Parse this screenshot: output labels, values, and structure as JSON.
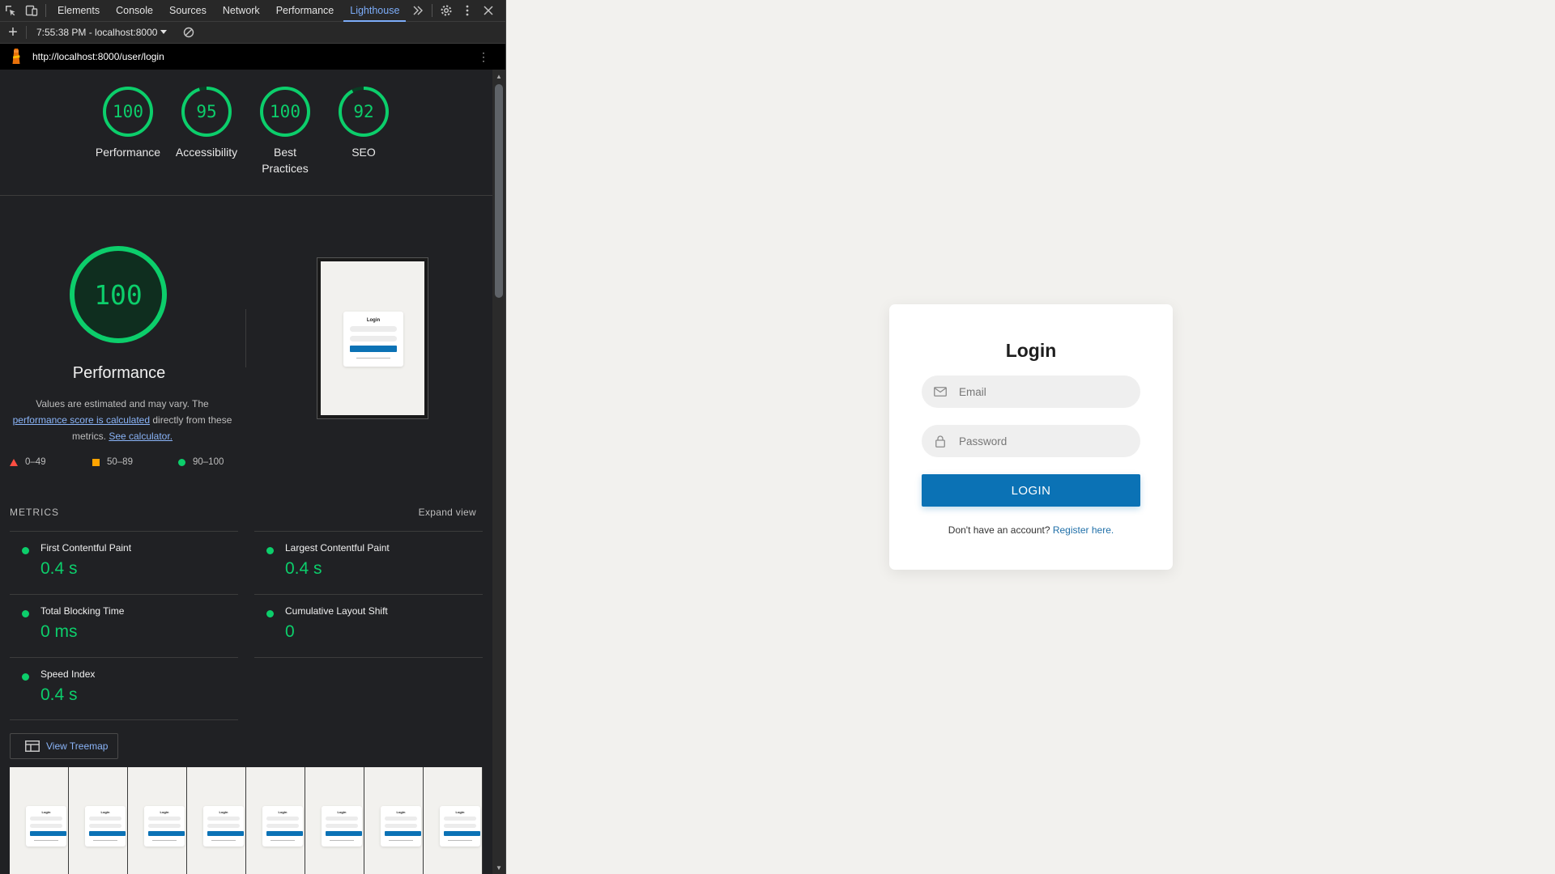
{
  "devtools": {
    "tabs": [
      {
        "label": "Elements"
      },
      {
        "label": "Console"
      },
      {
        "label": "Sources"
      },
      {
        "label": "Network"
      },
      {
        "label": "Performance"
      },
      {
        "label": "Lighthouse",
        "active": true
      }
    ],
    "report_select": "7:55:38 PM - localhost:8000",
    "url": "http://localhost:8000/user/login",
    "accent_color": "#7cacf8",
    "pass_color": "#0cce6b"
  },
  "lighthouse": {
    "categories": [
      {
        "score": "100",
        "label": "Performance",
        "value": 100
      },
      {
        "score": "95",
        "label": "Accessibility",
        "value": 95
      },
      {
        "score": "100",
        "label": "Best Practices",
        "value": 100
      },
      {
        "score": "92",
        "label": "SEO",
        "value": 92
      }
    ],
    "performance": {
      "score": "100",
      "title": "Performance",
      "desc_1": "Values are estimated and may vary. The",
      "desc_link_1": "performance score is calculated",
      "desc_2": "directly from these metrics.",
      "desc_link_2": "See calculator."
    },
    "legend": {
      "fail": "0–49",
      "average": "50–89",
      "pass": "90–100",
      "fail_color": "#ff4e42",
      "average_color": "#ffa400",
      "pass_color": "#0cce6b"
    },
    "metrics_header": "METRICS",
    "expand_view": "Expand view",
    "metrics": [
      {
        "name": "First Contentful Paint",
        "value": "0.4 s"
      },
      {
        "name": "Largest Contentful Paint",
        "value": "0.4 s"
      },
      {
        "name": "Total Blocking Time",
        "value": "0 ms"
      },
      {
        "name": "Cumulative Layout Shift",
        "value": "0"
      },
      {
        "name": "Speed Index",
        "value": "0.4 s"
      }
    ],
    "treemap_button": "View Treemap",
    "thumbnail_title": "Login"
  },
  "login": {
    "title": "Login",
    "email_placeholder": "Email",
    "password_placeholder": "Password",
    "button_label": "LOGIN",
    "register_text": "Don't have an account?",
    "register_link": "Register here.",
    "button_color": "#0b72b5"
  }
}
